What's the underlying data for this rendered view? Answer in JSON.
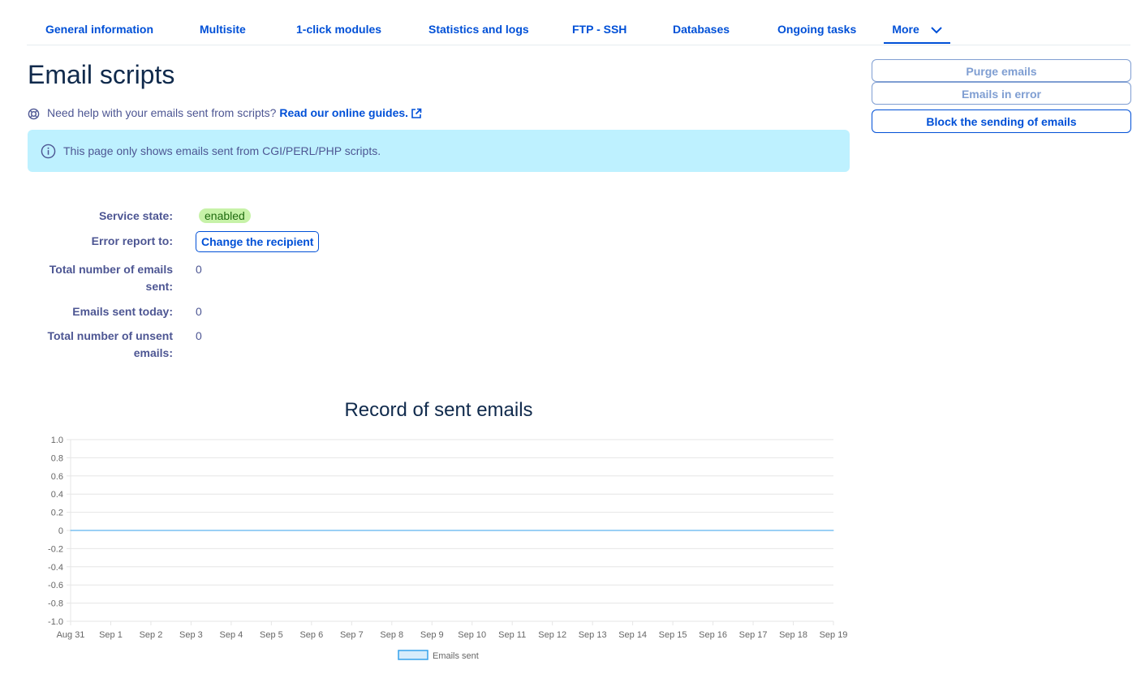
{
  "tabs": [
    {
      "label": "General information"
    },
    {
      "label": "Multisite"
    },
    {
      "label": "1-click modules"
    },
    {
      "label": "Statistics and logs"
    },
    {
      "label": "FTP - SSH"
    },
    {
      "label": "Databases"
    },
    {
      "label": "Ongoing tasks"
    },
    {
      "label": "More"
    }
  ],
  "page": {
    "title": "Email scripts",
    "help_text": "Need help with your emails sent from scripts?",
    "help_link": "Read our online guides.",
    "info_text": "This page only shows emails sent from CGI/PERL/PHP scripts."
  },
  "actions": {
    "purge": "Purge emails",
    "errors": "Emails in error",
    "block": "Block the sending of emails"
  },
  "details": {
    "service_state_label": "Service state:",
    "service_state_value": "enabled",
    "error_report_label": "Error report to:",
    "change_recipient": "Change the recipient",
    "total_sent_label_1": "Total number of emails",
    "total_sent_label_2": "sent:",
    "total_sent_value": "0",
    "sent_today_label": "Emails sent today:",
    "sent_today_value": "0",
    "total_unsent_label_1": "Total number of unsent",
    "total_unsent_label_2": "emails:",
    "total_unsent_value": "0"
  },
  "chart_data": {
    "type": "line",
    "title": "Record of sent emails",
    "categories": [
      "Aug 31",
      "Sep 1",
      "Sep 2",
      "Sep 3",
      "Sep 4",
      "Sep 5",
      "Sep 6",
      "Sep 7",
      "Sep 8",
      "Sep 9",
      "Sep 10",
      "Sep 11",
      "Sep 12",
      "Sep 13",
      "Sep 14",
      "Sep 15",
      "Sep 16",
      "Sep 17",
      "Sep 18",
      "Sep 19"
    ],
    "series": [
      {
        "name": "Emails sent",
        "values": [
          0,
          0,
          0,
          0,
          0,
          0,
          0,
          0,
          0,
          0,
          0,
          0,
          0,
          0,
          0,
          0,
          0,
          0,
          0,
          0
        ]
      }
    ],
    "yticks": [
      "1.0",
      "0.8",
      "0.6",
      "0.4",
      "0.2",
      "0",
      "-0.2",
      "-0.4",
      "-0.6",
      "-0.8",
      "-1.0"
    ],
    "ylim": [
      -1,
      1
    ],
    "grid": true,
    "legend": "bottom",
    "series_color": "#36a2eb"
  }
}
